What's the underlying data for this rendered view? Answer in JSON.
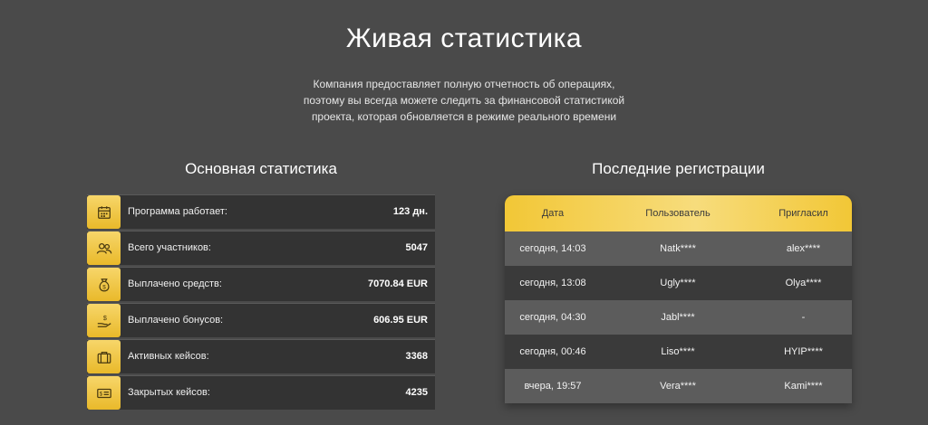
{
  "header": {
    "title": "Живая статистика",
    "subtitle": "Компания предоставляет полную отчетность об операциях, поэтому вы всегда можете следить за финансовой статистикой проекта, которая обновляется в режиме реального времени"
  },
  "stats": {
    "title": "Основная статистика",
    "items": [
      {
        "icon": "calendar-icon",
        "label": "Программа работает:",
        "value": "123 дн."
      },
      {
        "icon": "users-icon",
        "label": "Всего участников:",
        "value": "5047"
      },
      {
        "icon": "money-bag-icon",
        "label": "Выплачено средств:",
        "value": "7070.84 EUR"
      },
      {
        "icon": "hand-coin-icon",
        "label": "Выплачено бонусов:",
        "value": "606.95 EUR"
      },
      {
        "icon": "briefcase-icon",
        "label": "Активных кейсов:",
        "value": "3368"
      },
      {
        "icon": "bill-icon",
        "label": "Закрытых кейсов:",
        "value": "4235"
      }
    ]
  },
  "registrations": {
    "title": "Последние регистрации",
    "columns": [
      "Дата",
      "Пользователь",
      "Пригласил"
    ],
    "rows": [
      {
        "date": "сегодня, 14:03",
        "user": "Natk****",
        "inviter": "alex****"
      },
      {
        "date": "сегодня, 13:08",
        "user": "Ugly****",
        "inviter": "Olya****"
      },
      {
        "date": "сегодня, 04:30",
        "user": "Jabl****",
        "inviter": "-"
      },
      {
        "date": "сегодня, 00:46",
        "user": "Liso****",
        "inviter": "HYIP****"
      },
      {
        "date": "вчера, 19:57",
        "user": "Vera****",
        "inviter": "Kami****"
      }
    ]
  },
  "colors": {
    "background": "#4a4a4a",
    "accent": "#f2c736",
    "row_dark": "#333333"
  }
}
